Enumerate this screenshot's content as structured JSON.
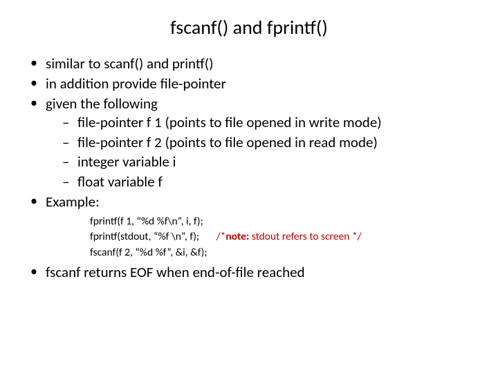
{
  "title": "fscanf() and fprintf()",
  "bullets": {
    "b1": "similar to scanf() and printf()",
    "b2": "in addition provide file-pointer",
    "b3": "given the following",
    "b3_sub": {
      "s1": "file-pointer f 1 (points to file opened in write mode)",
      "s2": "file-pointer f 2 (points to file opened in read mode)",
      "s3": "integer variable i",
      "s4": "float variable f"
    },
    "b4": "Example:",
    "code": {
      "l1": "fprintf(f 1, “%d %f\\n”, i, f);",
      "l2": "fprintf(stdout, “%f \\n”, f);",
      "l2_pad": "       ",
      "l2_note_pre": "/*",
      "l2_note_bold": "note:",
      "l2_note_rest": " stdout refers to screen */",
      "l3": "fscanf(f 2, “%d %f”, &i, &f);"
    },
    "b5": "fscanf returns EOF when end-of-file reached"
  }
}
